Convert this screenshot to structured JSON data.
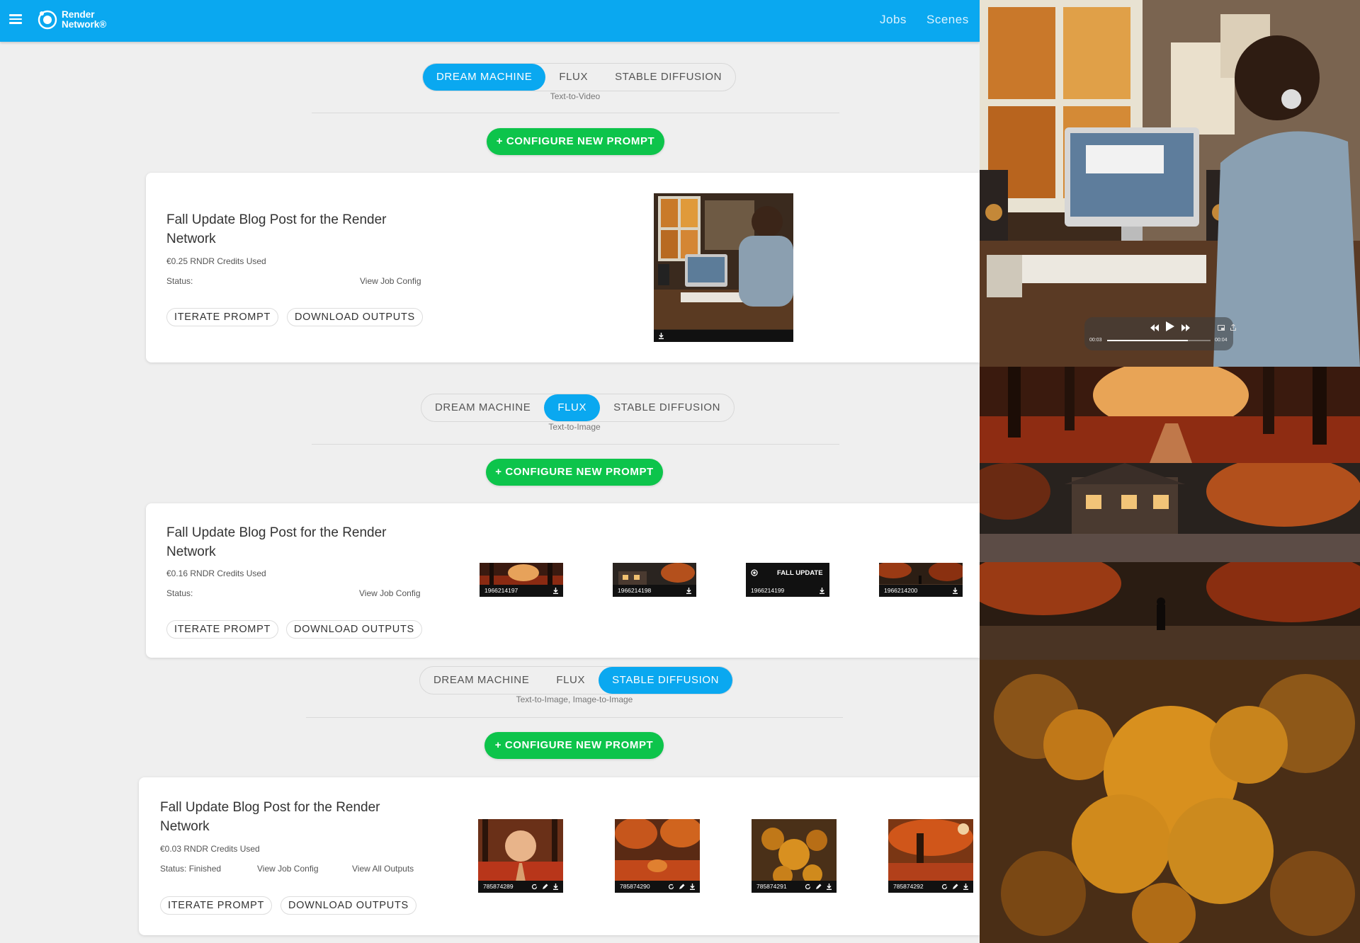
{
  "header": {
    "brand_line1": "Render",
    "brand_line2": "Network®",
    "nav": {
      "jobs": "Jobs",
      "scenes": "Scenes"
    }
  },
  "sections": [
    {
      "tabs": [
        "DREAM MACHINE",
        "FLUX",
        "STABLE DIFFUSION"
      ],
      "active_tab": "DREAM MACHINE",
      "subtitle": "Text-to-Video",
      "configure_label": "+ CONFIGURE NEW PROMPT",
      "job": {
        "title": "Fall Update Blog Post for the Render Network",
        "credits": "€0.25 RNDR Credits Used",
        "status": "Status:",
        "view_config": "View Job Config",
        "iterate": "ITERATE PROMPT",
        "download": "DOWNLOAD OUTPUTS",
        "outputs": [
          {
            "kind": "video",
            "icon": "download-icon"
          }
        ]
      }
    },
    {
      "tabs": [
        "DREAM MACHINE",
        "FLUX",
        "STABLE DIFFUSION"
      ],
      "active_tab": "FLUX",
      "subtitle": "Text-to-Image",
      "configure_label": "+ CONFIGURE NEW PROMPT",
      "job": {
        "title": "Fall Update Blog Post for the Render Network",
        "credits": "€0.16 RNDR Credits Used",
        "status": "Status:",
        "view_config": "View Job Config",
        "iterate": "ITERATE PROMPT",
        "download": "DOWNLOAD OUTPUTS",
        "outputs": [
          {
            "id": "1966214197"
          },
          {
            "id": "1966214198"
          },
          {
            "id": "1966214199",
            "caption": "FALL UPDATE"
          },
          {
            "id": "1966214200"
          }
        ]
      }
    },
    {
      "tabs": [
        "DREAM MACHINE",
        "FLUX",
        "STABLE DIFFUSION"
      ],
      "active_tab": "STABLE DIFFUSION",
      "subtitle": "Text-to-Image, Image-to-Image",
      "configure_label": "+ CONFIGURE NEW PROMPT",
      "job": {
        "title": "Fall Update Blog Post for the Render Network",
        "credits": "€0.03 RNDR Credits Used",
        "status": "Status: Finished",
        "view_config": "View Job Config",
        "view_all": "View All Outputs",
        "iterate": "ITERATE PROMPT",
        "download": "DOWNLOAD OUTPUTS",
        "outputs": [
          {
            "id": "785874289"
          },
          {
            "id": "785874290"
          },
          {
            "id": "785874291"
          },
          {
            "id": "785874292"
          }
        ]
      }
    }
  ],
  "preview_panel": {
    "player": {
      "elapsed": "00:03",
      "total": "00:04",
      "progress": 0.78
    }
  },
  "colors": {
    "brand_blue": "#0aa8f0",
    "configure_green": "#0dc44b",
    "background": "#efefef"
  }
}
